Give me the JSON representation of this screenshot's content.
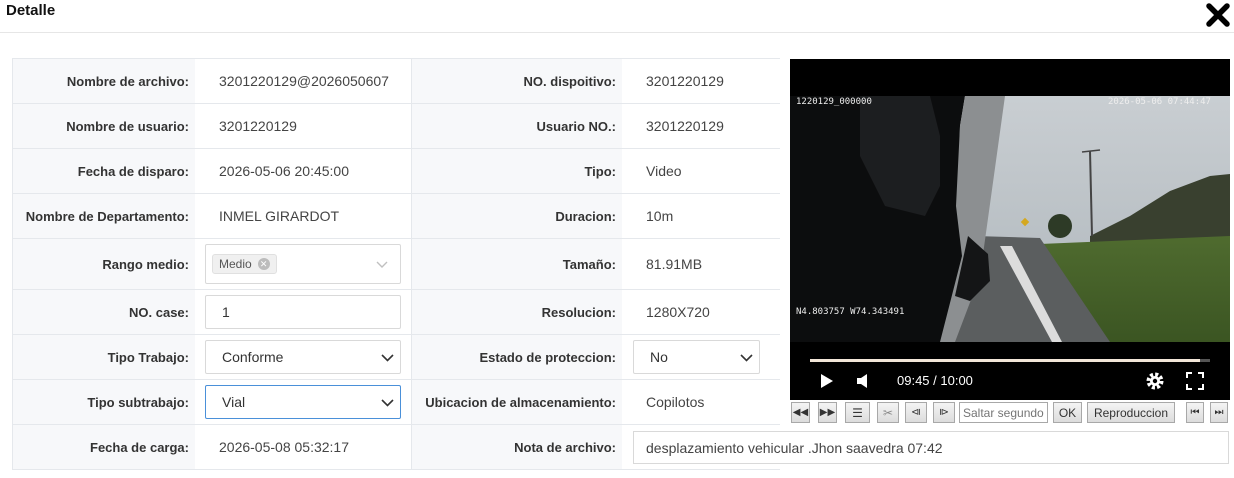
{
  "header": {
    "title": "Detalle"
  },
  "fields": {
    "nombre_archivo": {
      "label": "Nombre de archivo:",
      "value": "3201220129@2026050607"
    },
    "dispositivo": {
      "label": "NO. dispoitivo:",
      "value": "3201220129"
    },
    "nombre_usuario": {
      "label": "Nombre de usuario:",
      "value": "3201220129"
    },
    "usuario_no": {
      "label": "Usuario NO.:",
      "value": "3201220129"
    },
    "fecha_disparo": {
      "label": "Fecha de disparo:",
      "value": "2026-05-06 20:45:00"
    },
    "tipo": {
      "label": "Tipo:",
      "value": "Video"
    },
    "departamento": {
      "label": "Nombre de Departamento:",
      "value": "INMEL GIRARDOT"
    },
    "duracion": {
      "label": "Duracion:",
      "value": "10m"
    },
    "rango_medio": {
      "label": "Rango medio:",
      "tag": "Medio"
    },
    "tamano": {
      "label": "Tamaño:",
      "value": "81.91MB"
    },
    "no_case": {
      "label": "NO. case:",
      "value": "1"
    },
    "resolucion": {
      "label": "Resolucion:",
      "value": "1280X720"
    },
    "tipo_trabajo": {
      "label": "Tipo Trabajo:",
      "value": "Conforme"
    },
    "estado_proteccion": {
      "label": "Estado de proteccion:",
      "value": "No"
    },
    "tipo_subtrabajo": {
      "label": "Tipo subtrabajo:",
      "value": "Vial"
    },
    "ubicacion": {
      "label": "Ubicacion de almacenamiento:",
      "value": "Copilotos"
    },
    "fecha_carga": {
      "label": "Fecha de carga:",
      "value": "2026-05-08 05:32:17"
    },
    "nota": {
      "label": "Nota de archivo:",
      "value": "desplazamiento vehicular .Jhon saavedra 07:42"
    }
  },
  "player": {
    "overlay_id": "1220129_000000",
    "overlay_datetime": "2026-05-06 07:44:47",
    "overlay_gps": "N4.803757 W74.343491",
    "time": "09:45 / 10:00",
    "progress": 0.975
  },
  "toolbar": {
    "jump_placeholder": "Saltar segundo",
    "ok_label": "OK",
    "play_label": "Reproduccion"
  },
  "colors": {
    "accent": "#4a90d9",
    "label_bg": "#f7f8fa",
    "border": "#e5e8ec"
  }
}
